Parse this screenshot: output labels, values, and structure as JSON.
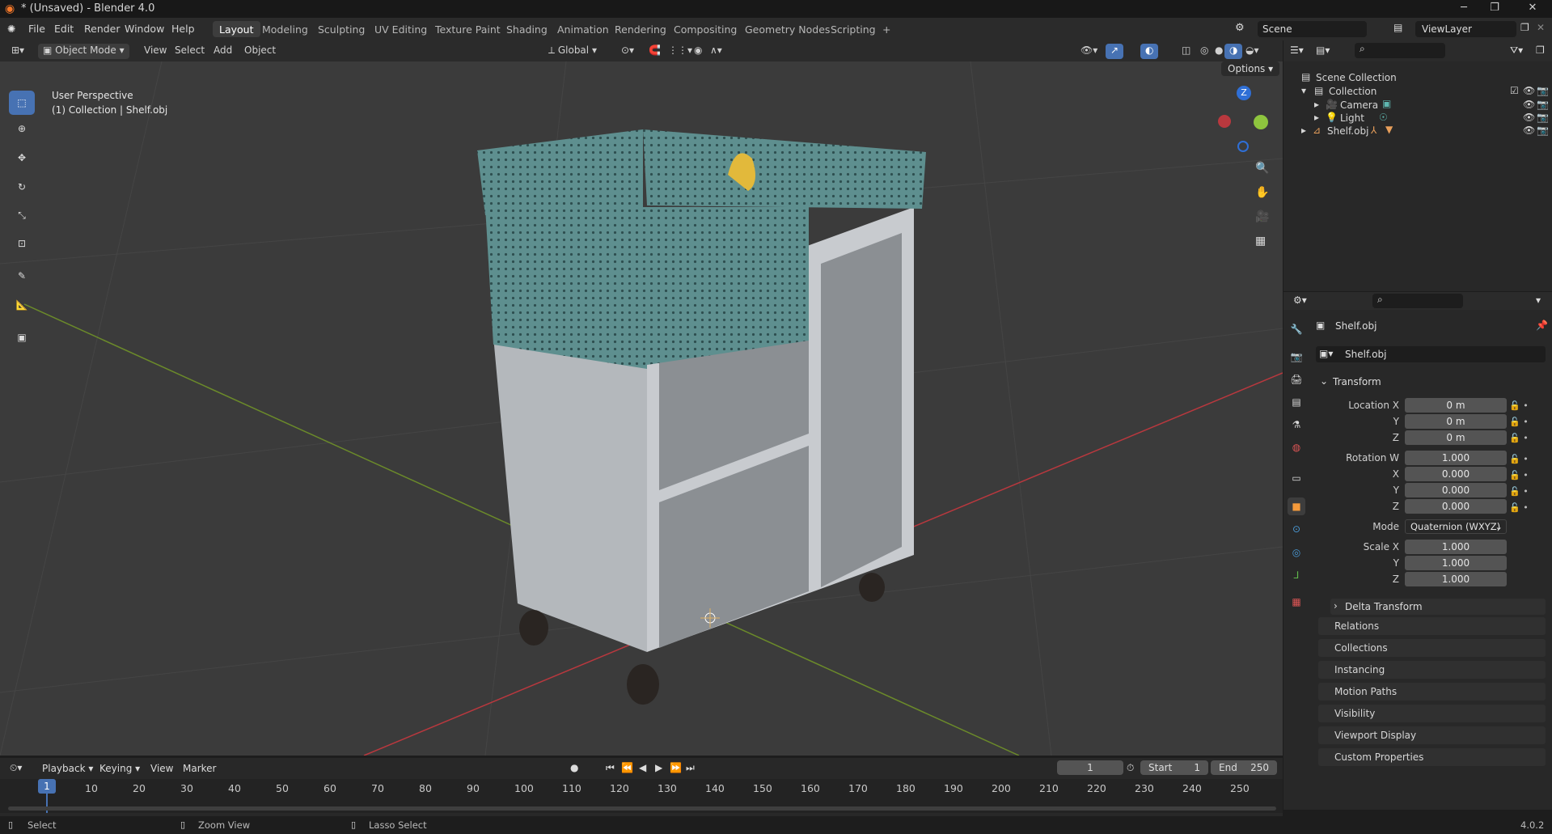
{
  "window": {
    "title": "* (Unsaved) - Blender 4.0",
    "minimize": "─",
    "maximize": "❐",
    "close": "✕"
  },
  "menu": {
    "file": "File",
    "edit": "Edit",
    "render": "Render",
    "window": "Window",
    "help": "Help"
  },
  "workspaces": [
    "Layout",
    "Modeling",
    "Sculpting",
    "UV Editing",
    "Texture Paint",
    "Shading",
    "Animation",
    "Rendering",
    "Compositing",
    "Geometry Nodes",
    "Scripting"
  ],
  "add_workspace": "+",
  "scene": {
    "name": "Scene",
    "viewlayer": "ViewLayer"
  },
  "viewport": {
    "mode": "Object Mode",
    "view": "View",
    "select": "Select",
    "add": "Add",
    "object": "Object",
    "orientation": "Global",
    "options": "Options",
    "info_line1": "User Perspective",
    "info_line2": "(1) Collection | Shelf.obj",
    "gizmo_z": "Z"
  },
  "outliner": {
    "scene_collection": "Scene Collection",
    "collection": "Collection",
    "items": [
      {
        "name": "Camera"
      },
      {
        "name": "Light"
      },
      {
        "name": "Shelf.obj"
      }
    ]
  },
  "properties": {
    "object_name": "Shelf.obj",
    "object_field": "Shelf.obj",
    "transform": "Transform",
    "location_label": "Location X",
    "loc": [
      "0 m",
      "0 m",
      "0 m"
    ],
    "rotation_label": "Rotation W",
    "rot": [
      "1.000",
      "0.000",
      "0.000",
      "0.000"
    ],
    "mode_label": "Mode",
    "mode_value": "Quaternion (WXYZ)",
    "scale_label": "Scale X",
    "scale": [
      "1.000",
      "1.000",
      "1.000"
    ],
    "y": "Y",
    "x": "X",
    "z": "Z",
    "delta": "Delta Transform",
    "panels": [
      "Relations",
      "Collections",
      "Instancing",
      "Motion Paths",
      "Visibility",
      "Viewport Display",
      "Custom Properties"
    ]
  },
  "timeline": {
    "playback": "Playback",
    "keying": "Keying",
    "view": "View",
    "marker": "Marker",
    "current_frame": "1",
    "start_label": "Start",
    "start": "1",
    "end_label": "End",
    "end": "250",
    "frames": [
      "10",
      "20",
      "30",
      "40",
      "50",
      "60",
      "70",
      "80",
      "90",
      "100",
      "110",
      "120",
      "130",
      "140",
      "150",
      "160",
      "170",
      "180",
      "190",
      "200",
      "210",
      "220",
      "230",
      "240",
      "250"
    ]
  },
  "status": {
    "select": "Select",
    "zoom": "Zoom View",
    "lasso": "Lasso Select",
    "version": "4.0.2"
  },
  "colors": {
    "accent": "#4772b3",
    "shelf_panel": "#5e8f8f",
    "shelf_body": "#c8cbcf",
    "x_axis": "#b9383e",
    "y_axis": "#6b8a2a"
  }
}
